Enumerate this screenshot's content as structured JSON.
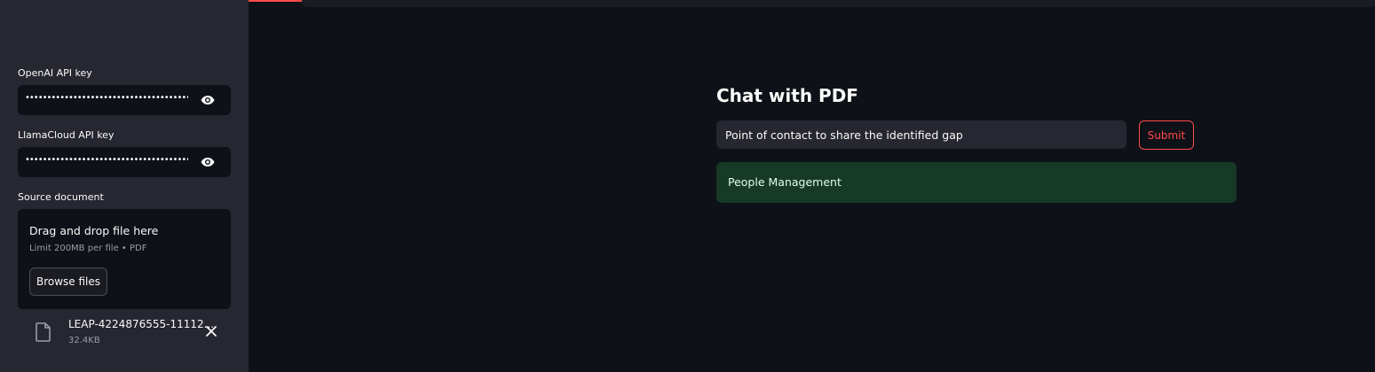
{
  "sidebar": {
    "openai_label": "OpenAI API key",
    "openai_value": "••••••••••••••••••••••••••••••••••••••••••••••••••",
    "llamacloud_label": "LlamaCloud API key",
    "llamacloud_value": "••••••••••••••••••••••••••••••••••••••••••••••••••",
    "source_label": "Source document",
    "uploader": {
      "title": "Drag and drop file here",
      "limit": "Limit 200MB per file • PDF",
      "browse_label": "Browse files"
    },
    "file": {
      "name": "LEAP-4224876555-11112...",
      "size": "32.4KB",
      "icon": "file-icon"
    }
  },
  "main": {
    "title": "Chat with PDF",
    "query_value": "Point of contact to share the identified gap",
    "submit_label": "Submit",
    "result_text": "People Management"
  },
  "colors": {
    "accent": "#ff4b4b",
    "background": "#0e1117",
    "sidebar": "#262730",
    "success_bg": "#173928"
  }
}
